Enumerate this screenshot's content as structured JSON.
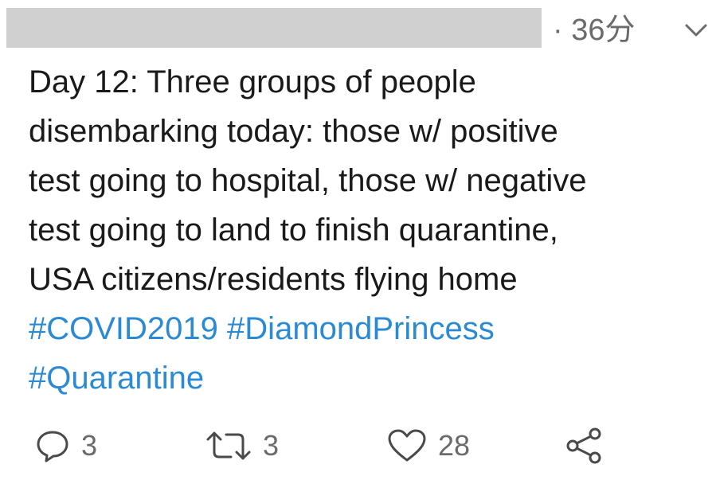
{
  "header": {
    "timestamp": "· 36分"
  },
  "tweet": {
    "lines": [
      "Day 12: Three groups of people",
      "disembarking today: those w/ positive",
      "test going to hospital, those w/ negative",
      "test going to land to finish quarantine,",
      "USA citizens/residents flying home"
    ],
    "hashtags": [
      "#COVID2019",
      "#DiamondPrincess",
      "#Quarantine"
    ]
  },
  "actions": {
    "reply_count": "3",
    "retweet_count": "3",
    "like_count": "28"
  },
  "colors": {
    "hashtag": "#2a8ad3",
    "muted": "#6b6b6b",
    "redacted": "#d0d0d0"
  },
  "icons": [
    "chevron-down-icon",
    "reply-icon",
    "retweet-icon",
    "like-icon",
    "share-icon"
  ]
}
